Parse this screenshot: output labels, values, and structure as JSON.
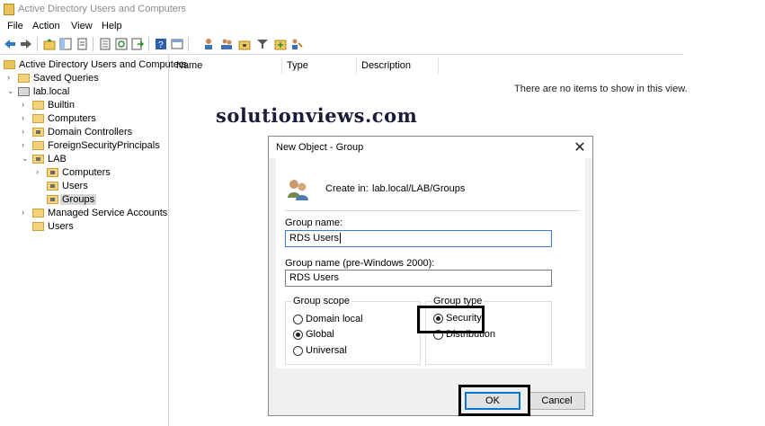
{
  "window": {
    "title": "Active Directory Users and Computers"
  },
  "menu": [
    "File",
    "Action",
    "View",
    "Help"
  ],
  "toolbar": {
    "icons": [
      "back-arrow-icon",
      "forward-arrow-icon",
      "up-folder-icon",
      "show-tree-icon",
      "properties-icon",
      "export-list-icon",
      "refresh-icon",
      "export-icon",
      "help-icon",
      "mmc-icon",
      "new-user-icon",
      "new-group-icon",
      "new-ou-icon",
      "filter-icon",
      "add-to-group-icon",
      "delegate-icon"
    ]
  },
  "tree": [
    {
      "label": "Active Directory Users and Computers",
      "level": 0,
      "arrow": "",
      "icon": "console-icon"
    },
    {
      "label": "Saved Queries",
      "level": 1,
      "arrow": "›",
      "icon": "folder-icon"
    },
    {
      "label": "lab.local",
      "level": 1,
      "arrow": "⌄",
      "icon": "domain-icon"
    },
    {
      "label": "Builtin",
      "level": 2,
      "arrow": "›",
      "icon": "folder-icon"
    },
    {
      "label": "Computers",
      "level": 2,
      "arrow": "›",
      "icon": "folder-icon"
    },
    {
      "label": "Domain Controllers",
      "level": 2,
      "arrow": "›",
      "icon": "ou-icon"
    },
    {
      "label": "ForeignSecurityPrincipals",
      "level": 2,
      "arrow": "›",
      "icon": "folder-icon"
    },
    {
      "label": "LAB",
      "level": 2,
      "arrow": "⌄",
      "icon": "ou-icon"
    },
    {
      "label": "Computers",
      "level": 3,
      "arrow": "›",
      "icon": "ou-icon"
    },
    {
      "label": "Users",
      "level": 3,
      "arrow": "",
      "icon": "ou-icon"
    },
    {
      "label": "Groups",
      "level": 3,
      "arrow": "",
      "icon": "ou-icon",
      "selected": true
    },
    {
      "label": "Managed Service Accounts",
      "level": 2,
      "arrow": "›",
      "icon": "folder-icon"
    },
    {
      "label": "Users",
      "level": 2,
      "arrow": "",
      "icon": "folder-icon"
    }
  ],
  "list": {
    "columns": [
      "Name",
      "Type",
      "Description"
    ],
    "empty_message": "There are no items to show in this view."
  },
  "watermark": "solutionviews.com",
  "dialog": {
    "title": "New Object - Group",
    "close": "✕",
    "create_in_label": "Create in:",
    "create_in_path": "lab.local/LAB/Groups",
    "group_name_label": "Group name:",
    "group_name_value": "RDS Users",
    "pre2000_label": "Group name (pre-Windows 2000):",
    "pre2000_value": "RDS Users",
    "scope": {
      "title": "Group scope",
      "options": [
        {
          "label": "Domain local",
          "checked": false
        },
        {
          "label": "Global",
          "checked": true
        },
        {
          "label": "Universal",
          "checked": false
        }
      ]
    },
    "type": {
      "title": "Group type",
      "options": [
        {
          "label": "Security",
          "checked": true
        },
        {
          "label": "Distribution",
          "checked": false
        }
      ]
    },
    "ok_label": "OK",
    "cancel_label": "Cancel"
  }
}
